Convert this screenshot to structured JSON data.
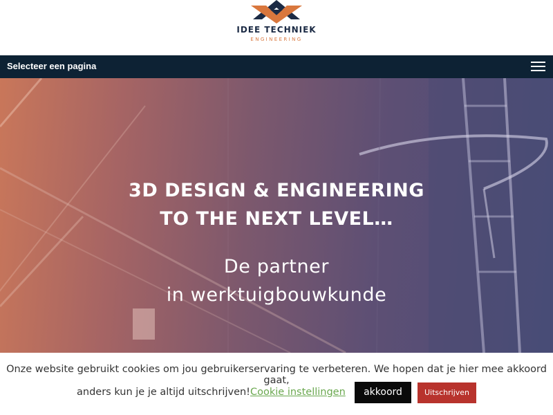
{
  "brand": {
    "title": "IDEE TECHNIEK",
    "subtitle": "ENGINEERING",
    "colors": {
      "navy": "#1b2a44",
      "orange": "#d9773d"
    }
  },
  "nav": {
    "label": "Selecteer een pagina",
    "menu_icon": "hamburger-menu-icon"
  },
  "hero": {
    "headline_line1": "3D DESIGN & ENGINEERING",
    "headline_line2": "TO THE NEXT LEVEL…",
    "sub_line1": "De partner",
    "sub_line2": "in werktuigbouwkunde"
  },
  "cookie": {
    "text_line1": "Onze website gebruikt cookies om jou gebruikerservaring te verbeteren. We hopen dat je hier mee akkoord gaat,",
    "text_line2": "anders kun je je altijd uitschrijven!",
    "settings_link": "Cookie instellingen",
    "accept_label": "akkoord",
    "reject_label": "Uitschrijven",
    "colors": {
      "accept": "#0a0a0a",
      "reject": "#b8332d",
      "link": "#6aa84f"
    }
  }
}
